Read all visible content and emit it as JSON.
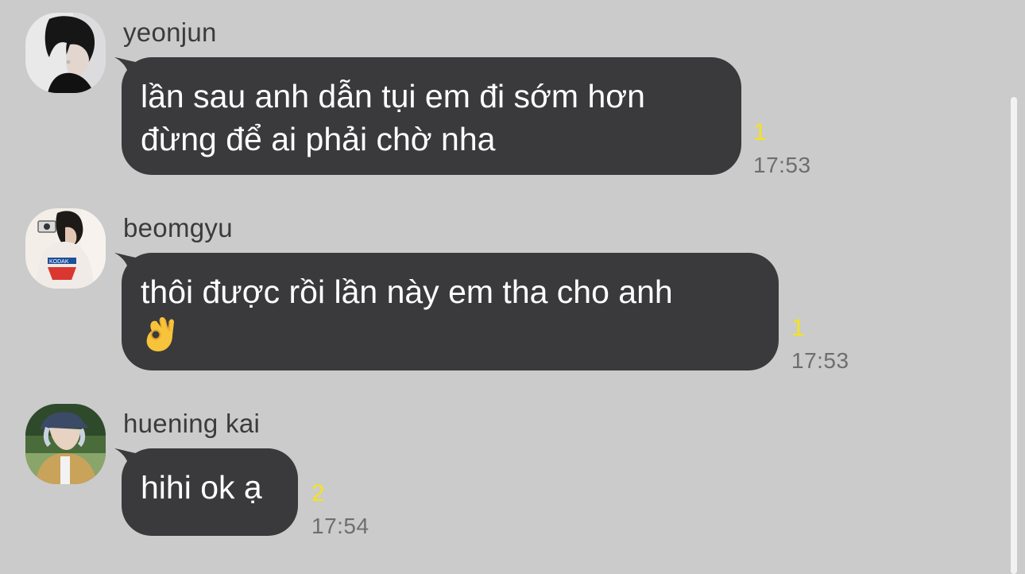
{
  "messages": [
    {
      "sender": "yeonjun",
      "lines": [
        "lần sau anh dẫn tụi em đi sớm hơn",
        "đừng để ai phải chờ nha"
      ],
      "unread": "1",
      "time": "17:53"
    },
    {
      "sender": "beomgyu",
      "lines": [
        "thôi được rồi lần này em tha cho anh"
      ],
      "emoji": "ok-hand-icon",
      "unread": "1",
      "time": "17:53"
    },
    {
      "sender": "huening kai",
      "lines": [
        "hihi ok ạ"
      ],
      "unread": "2",
      "time": "17:54"
    }
  ],
  "colors": {
    "background": "#cbcbcb",
    "bubble": "#3a3a3c",
    "bubble_text": "#ffffff",
    "unread": "#f5e31c",
    "time": "#6e6e6e",
    "sender": "#3b3b3b"
  }
}
